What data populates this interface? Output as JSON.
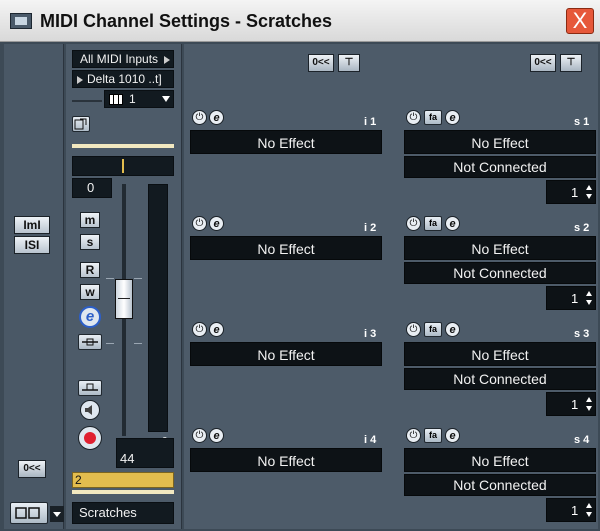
{
  "window": {
    "title": "MIDI Channel Settings - Scratches",
    "close_label": "X"
  },
  "left_strip": {
    "buttons": [
      {
        "label": "ImI",
        "icon": "midi-inserts-icon"
      },
      {
        "label": "ISI",
        "icon": "midi-sends-icon"
      }
    ],
    "reset_label": "0<<"
  },
  "channel": {
    "input": "All MIDI Inputs",
    "output": "Delta 1010 ..t]",
    "midi_channel": "1",
    "pan_value": "0",
    "volume_value": "44",
    "volume_fraction": 0.55,
    "meter_value": "0",
    "buttons": {
      "mute": "m",
      "solo": "s",
      "read": "R",
      "write": "w",
      "edit": "e"
    },
    "track_number": "2",
    "track_name": "Scratches"
  },
  "inserts": {
    "header_reset": "0<<",
    "header_bypass": "⊤",
    "slots": [
      {
        "label": "i 1",
        "effect": "No Effect"
      },
      {
        "label": "i 2",
        "effect": "No Effect"
      },
      {
        "label": "i 3",
        "effect": "No Effect"
      },
      {
        "label": "i 4",
        "effect": "No Effect"
      }
    ]
  },
  "sends": {
    "header_reset": "0<<",
    "header_bypass": "⊤",
    "slots": [
      {
        "label": "s 1",
        "effect": "No Effect",
        "connection": "Not Connected",
        "value": "1"
      },
      {
        "label": "s 2",
        "effect": "No Effect",
        "connection": "Not Connected",
        "value": "1"
      },
      {
        "label": "s 3",
        "effect": "No Effect",
        "connection": "Not Connected",
        "value": "1"
      },
      {
        "label": "s 4",
        "effect": "No Effect",
        "connection": "Not Connected",
        "value": "1"
      }
    ]
  },
  "colors": {
    "background": "#3d4a56",
    "panel": "#4d5b69",
    "display": "#121a20",
    "track_color": "#e3bd4e",
    "record": "#e02030"
  }
}
